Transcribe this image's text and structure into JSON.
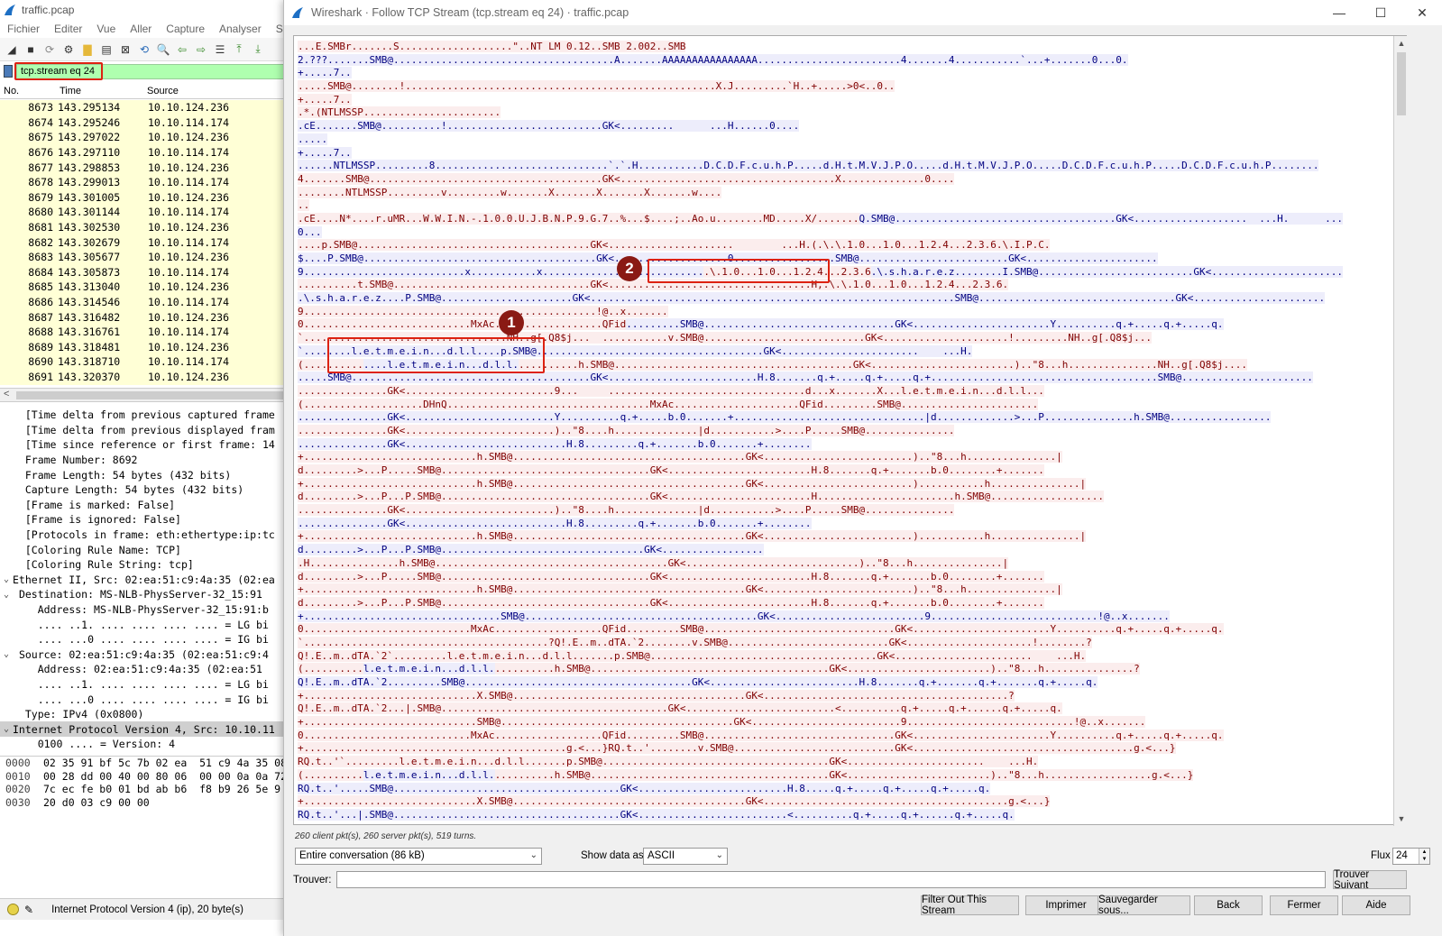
{
  "main_window": {
    "title": "traffic.pcap",
    "menu": [
      "Fichier",
      "Editer",
      "Vue",
      "Aller",
      "Capture",
      "Analyser",
      "Stat"
    ],
    "filter": "tcp.stream eq 24",
    "columns": {
      "no": "No.",
      "time": "Time",
      "source": "Source"
    },
    "packets": [
      {
        "no": "8673",
        "time": "143.295134",
        "src": "10.10.124.236"
      },
      {
        "no": "8674",
        "time": "143.295246",
        "src": "10.10.114.174"
      },
      {
        "no": "8675",
        "time": "143.297022",
        "src": "10.10.124.236"
      },
      {
        "no": "8676",
        "time": "143.297110",
        "src": "10.10.114.174"
      },
      {
        "no": "8677",
        "time": "143.298853",
        "src": "10.10.124.236"
      },
      {
        "no": "8678",
        "time": "143.299013",
        "src": "10.10.114.174"
      },
      {
        "no": "8679",
        "time": "143.301005",
        "src": "10.10.124.236"
      },
      {
        "no": "8680",
        "time": "143.301144",
        "src": "10.10.114.174"
      },
      {
        "no": "8681",
        "time": "143.302530",
        "src": "10.10.124.236"
      },
      {
        "no": "8682",
        "time": "143.302679",
        "src": "10.10.114.174"
      },
      {
        "no": "8683",
        "time": "143.305677",
        "src": "10.10.124.236"
      },
      {
        "no": "8684",
        "time": "143.305873",
        "src": "10.10.114.174"
      },
      {
        "no": "8685",
        "time": "143.313040",
        "src": "10.10.124.236"
      },
      {
        "no": "8686",
        "time": "143.314546",
        "src": "10.10.114.174"
      },
      {
        "no": "8687",
        "time": "143.316482",
        "src": "10.10.124.236"
      },
      {
        "no": "8688",
        "time": "143.316761",
        "src": "10.10.114.174"
      },
      {
        "no": "8689",
        "time": "143.318481",
        "src": "10.10.124.236"
      },
      {
        "no": "8690",
        "time": "143.318710",
        "src": "10.10.114.174"
      },
      {
        "no": "8691",
        "time": "143.320370",
        "src": "10.10.124.236"
      }
    ],
    "details": [
      {
        "tw": "",
        "indent": "  ",
        "text": "[Time delta from previous captured frame"
      },
      {
        "tw": "",
        "indent": "  ",
        "text": "[Time delta from previous displayed fram"
      },
      {
        "tw": "",
        "indent": "  ",
        "text": "[Time since reference or first frame: 14"
      },
      {
        "tw": "",
        "indent": "  ",
        "text": "Frame Number: 8692"
      },
      {
        "tw": "",
        "indent": "  ",
        "text": "Frame Length: 54 bytes (432 bits)"
      },
      {
        "tw": "",
        "indent": "  ",
        "text": "Capture Length: 54 bytes (432 bits)"
      },
      {
        "tw": "",
        "indent": "  ",
        "text": "[Frame is marked: False]"
      },
      {
        "tw": "",
        "indent": "  ",
        "text": "[Frame is ignored: False]"
      },
      {
        "tw": "",
        "indent": "  ",
        "text": "[Protocols in frame: eth:ethertype:ip:tc"
      },
      {
        "tw": "",
        "indent": "  ",
        "text": "[Coloring Rule Name: TCP]"
      },
      {
        "tw": "",
        "indent": "  ",
        "text": "[Coloring Rule String: tcp]"
      },
      {
        "tw": "v",
        "indent": "",
        "text": "Ethernet II, Src: 02:ea:51:c9:4a:35 (02:ea"
      },
      {
        "tw": "v",
        "indent": " ",
        "text": "Destination: MS-NLB-PhysServer-32_15:91"
      },
      {
        "tw": "",
        "indent": "    ",
        "text": "Address: MS-NLB-PhysServer-32_15:91:b"
      },
      {
        "tw": "",
        "indent": "    ",
        "text": ".... ..1. .... .... .... .... = LG bi"
      },
      {
        "tw": "",
        "indent": "    ",
        "text": ".... ...0 .... .... .... .... = IG bi"
      },
      {
        "tw": "v",
        "indent": " ",
        "text": "Source: 02:ea:51:c9:4a:35 (02:ea:51:c9:4"
      },
      {
        "tw": "",
        "indent": "    ",
        "text": "Address: 02:ea:51:c9:4a:35 (02:ea:51"
      },
      {
        "tw": "",
        "indent": "    ",
        "text": ".... ..1. .... .... .... .... = LG bi"
      },
      {
        "tw": "",
        "indent": "    ",
        "text": ".... ...0 .... .... .... .... = IG bi"
      },
      {
        "tw": "",
        "indent": "  ",
        "text": "Type: IPv4 (0x0800)"
      },
      {
        "tw": "v",
        "indent": "",
        "text": "Internet Protocol Version 4, Src: 10.10.11"
      },
      {
        "tw": "",
        "indent": "    ",
        "text": "0100 .... = Version: 4"
      }
    ],
    "bytes": [
      {
        "off": "0000",
        "hex": "02 35 91 bf 5c 7b 02 ea  51 c9 4a 35 08"
      },
      {
        "off": "0010",
        "hex": "00 28 dd 00 40 00 80 06  00 00 0a 0a 72"
      },
      {
        "off": "0020",
        "hex": "7c ec fe b0 01 bd ab b6  f8 b9 26 5e 9"
      },
      {
        "off": "0030",
        "hex": "20 d0 03 c9 00 00"
      }
    ],
    "status": "Internet Protocol Version 4 (ip), 20 byte(s)"
  },
  "dialog": {
    "title": "Wireshark · Follow TCP Stream (tcp.stream eq 24) · traffic.pcap",
    "stats": "260 client pkt(s), 260 server pkt(s), 519 turns.",
    "conversation": "Entire conversation (86 kB)",
    "show_label": "Show data as",
    "show_value": "ASCII",
    "flux_label": "Flux",
    "flux_value": "24",
    "find_label": "Trouver:",
    "find_value": "",
    "buttons": {
      "find_next": "Trouver Suivant",
      "filter_out": "Filter Out This Stream",
      "print": "Imprimer",
      "save": "Sauvegarder sous...",
      "back": "Back",
      "close": "Fermer",
      "help": "Aide"
    },
    "annotations": {
      "one": "1",
      "two": "2"
    },
    "stream_lines": [
      [
        [
          "c",
          "...E.SMBr.......S...................\"..NT LM 0.12..SMB 2.002..SMB"
        ]
      ],
      [
        [
          "s",
          "2.???.......SMB@.....................................A.......AAAAAAAAAAAAAAAA........................4.......4...........`...+.......0...0."
        ]
      ],
      [
        [
          "s",
          "+.....7.."
        ]
      ],
      [
        [
          "c",
          ".....SMB@........!....................................................X.J.........`H..+.....>0<..0.."
        ]
      ],
      [
        [
          "c",
          "+.....7.."
        ]
      ],
      [
        [
          "c",
          ".*.(NTLMSSP......................."
        ]
      ],
      [
        [
          "s",
          ".cE.......SMB@..........!..........................GK<.........      ...H......0...."
        ]
      ],
      [
        [
          "s",
          "....."
        ]
      ],
      [
        [
          "s",
          "+.....7.."
        ]
      ],
      [
        [
          "s",
          "......NTLMSSP.........8.............................`.`.H...........D.C.D.F.c.u.h.P.....d.H.t.M.V.J.P.O.....d.H.t.M.V.J.P.O.....D.C.D.F.c.u.h.P.....D.C.D.F.c.u.h.P........"
        ]
      ],
      [
        [
          "c",
          "4.......SMB@.......................................GK<....................................X..............0...."
        ]
      ],
      [
        [
          "c",
          "........NTLMSSP.........v.........w.......X.......X.......X.......w...."
        ]
      ],
      [
        [
          "c",
          ".."
        ]
      ],
      [
        [
          "c",
          ".cE....N*....r.uMR...W.W.I.N.-.1.0.0.U.J.B.N.P.9.G.7..%...$....;..Ao.u........MD.....X/......."
        ],
        [
          "s",
          "Q.SMB@.....................................GK<...................  ...H.      ..."
        ]
      ],
      [
        [
          "s",
          "0..."
        ]
      ],
      [
        [
          "c",
          "....p.SMB@.......................................GK<.....................        ...H.(.\\.\\.1.0...1.0...1.2.4...2.3.6.\\.I.P.C."
        ]
      ],
      [
        [
          "s",
          "$....P.SMB@.......................................GK<...................0.................SMB@.........................GK<......................"
        ]
      ],
      [
        [
          "s",
          "9...........................x...........x..........................."
        ],
        [
          "c",
          ".\\.1.0...1.0...1.2.4...2.3.6"
        ],
        [
          "s",
          ".\\.s.h.a.r.e.z........I.SMB@..........................GK<......................"
        ]
      ],
      [
        [
          "c",
          "..........t.SMB@.................................GK<..................................H,.\\.\\.1.0...1.0...1.2.4...2.3.6."
        ]
      ],
      [
        [
          "s",
          ".\\.s.h.a.r.e.z....P.SMB@......................GK<.............................................................SMB@.................................GK<......................"
        ]
      ],
      [
        [
          "c",
          "9.................................................!@..x......."
        ]
      ],
      [
        [
          "c",
          "0............................MxAc..................QFid"
        ],
        [
          "s",
          ".........SMB@................................GK<.......................Y..........q.+.....q.+.....q."
        ]
      ],
      [
        [
          "c",
          "`..................................NH..g[.Q8$j...  ...........v.SMB@...........................GK<.....................!.........NH..g[.Q8$j..."
        ]
      ],
      [
        [
          "s",
          "`........l.e.t.m.e.i.n...d.l.l....p.SMB@......................................GK<.......................    ...H."
        ]
      ],
      [
        [
          "c",
          "(.........."
        ],
        [
          "s",
          "....l.e.t.m.e.i.n...d.l.l."
        ],
        [
          "c",
          "..........h.SMB@........................................GK<........................)..\"8...h...............NH..g[.Q8$j...."
        ]
      ],
      [
        [
          "s",
          ".....SMB@........................................GK<.........................H.8.......q.+.....q.+.....q.+......................................SMB@......................"
        ]
      ],
      [
        [
          "c",
          "...............GK<.........................9...     .................................d...x.......X...l.e.t.m.e.i.n...d.l.l..."
        ]
      ],
      [
        [
          "c",
          "(....................DHnQ..................................MxAc.....................QFid.........SMB@......................."
        ]
      ],
      [
        [
          "s",
          "...............GK<.........................Y..........q.+.....b.0.......+................................|d.............>...P...............h.SMB@................."
        ]
      ],
      [
        [
          "c",
          "...............GK<.........................)..\"8....h..............|d...........>....P.....SMB@..............."
        ]
      ],
      [
        [
          "s",
          "...............GK<...........................H.8.........q.+.......b.0.......+........"
        ]
      ],
      [
        [
          "c",
          "+.............................h.SMB@.......................................GK<.........................)..\"8...h...............|"
        ]
      ],
      [
        [
          "c",
          "d.........>...P.....SMB@...................................GK<........................H.8.......q.+.......b.0........+......."
        ]
      ],
      [
        [
          "c",
          "+.............................h.SMB@.......................................GK<.........................)...........h...............|"
        ]
      ],
      [
        [
          "c",
          "d.........>...P...P.SMB@...................................GK<........................H.......................h.SMB@..................."
        ]
      ],
      [
        [
          "c",
          "...............GK<.........................)..\"8....h..............|d...........>....P.....SMB@..............."
        ]
      ],
      [
        [
          "s",
          "...............GK<...........................H.8.........q.+.......b.0.......+........"
        ]
      ],
      [
        [
          "c",
          "+.............................h.SMB@.......................................GK<.........................)...........h...............|"
        ]
      ],
      [
        [
          "s",
          "d.........>...P...P.SMB@..................................GK<................."
        ]
      ],
      [
        [
          "c",
          ".H...............h.SMB@.......................................GK<.............................)..\"8...h...............|"
        ]
      ],
      [
        [
          "c",
          "d.........>...P.....SMB@...................................GK<........................H.8.......q.+.......b.0........+......."
        ]
      ],
      [
        [
          "c",
          "+.............................h.SMB@.......................................GK<.........................)..\"8...h...............|"
        ]
      ],
      [
        [
          "c",
          "d.........>...P...P.SMB@...................................GK<........................H.8.......q.+.......b.0........+......."
        ]
      ],
      [
        [
          "s",
          "+.................................SMB@.......................................GK<.........................9............................!@..x......."
        ]
      ],
      [
        [
          "c",
          "0............................MxAc..................QFid.........SMB@................................GK<.......................Y..........q.+.....q.+.....q."
        ]
      ],
      [
        [
          "c",
          "`.........................................?Q!.E..m..dTA.`2........v.SMB@...........................GK<.....................!........?"
        ]
      ],
      [
        [
          "c",
          "Q!.E..m..dTA.`2`.........l.e.t.m.e.i.n...d.l.l.......p.SMB@......................................GK<.......................    ...H."
        ]
      ],
      [
        [
          "c",
          "(.........."
        ],
        [
          "s",
          "l.e.t.m.e.i.n...d.l.l."
        ],
        [
          "c",
          "..........h.SMB@........................................GK<........................)..\"8...h...............?"
        ]
      ],
      [
        [
          "s",
          "Q!.E..m..dTA.`2.........SMB@......................................GK<.........................H.8.......q.+.......q.+.......q.+.....q."
        ]
      ],
      [
        [
          "c",
          "+.............................X.SMB@.......................................GK<.........................................?"
        ]
      ],
      [
        [
          "c",
          "Q!.E..m..dTA.`2...|.SMB@......................................GK<.........................<..........q.+.....q.+......q.+.....q."
        ]
      ],
      [
        [
          "c",
          "+.............................SMB@.......................................GK<.........................9............................!@..x......."
        ]
      ],
      [
        [
          "c",
          "0............................MxAc..................QFid.........SMB@................................GK<.......................Y..........q.+.....q.+.....q."
        ]
      ],
      [
        [
          "c",
          "+............................................g.<...}RQ.t..'........v.SMB@...........................GK<.....................................g.<...}"
        ]
      ],
      [
        [
          "c",
          "RQ.t..'`.........l.e.t.m.e.i.n...d.l.l.......p.SMB@......................................GK<.......................    ...H."
        ]
      ],
      [
        [
          "c",
          "(.........."
        ],
        [
          "s",
          "l.e.t.m.e.i.n...d.l.l."
        ],
        [
          "c",
          "..........h.SMB@........................................GK<........................)..\"8...h..................g.<...}"
        ]
      ],
      [
        [
          "s",
          "RQ.t..'.....SMB@......................................GK<.........................H.8.....q.+.....q.+.....q.+.....q."
        ]
      ],
      [
        [
          "c",
          "+.............................X.SMB@.......................................GK<.........................................g.<...}"
        ]
      ],
      [
        [
          "s",
          "RQ.t..'...|.SMB@......................................GK<.........................<..........q.+.....q.+......q.+.....q."
        ]
      ]
    ]
  }
}
